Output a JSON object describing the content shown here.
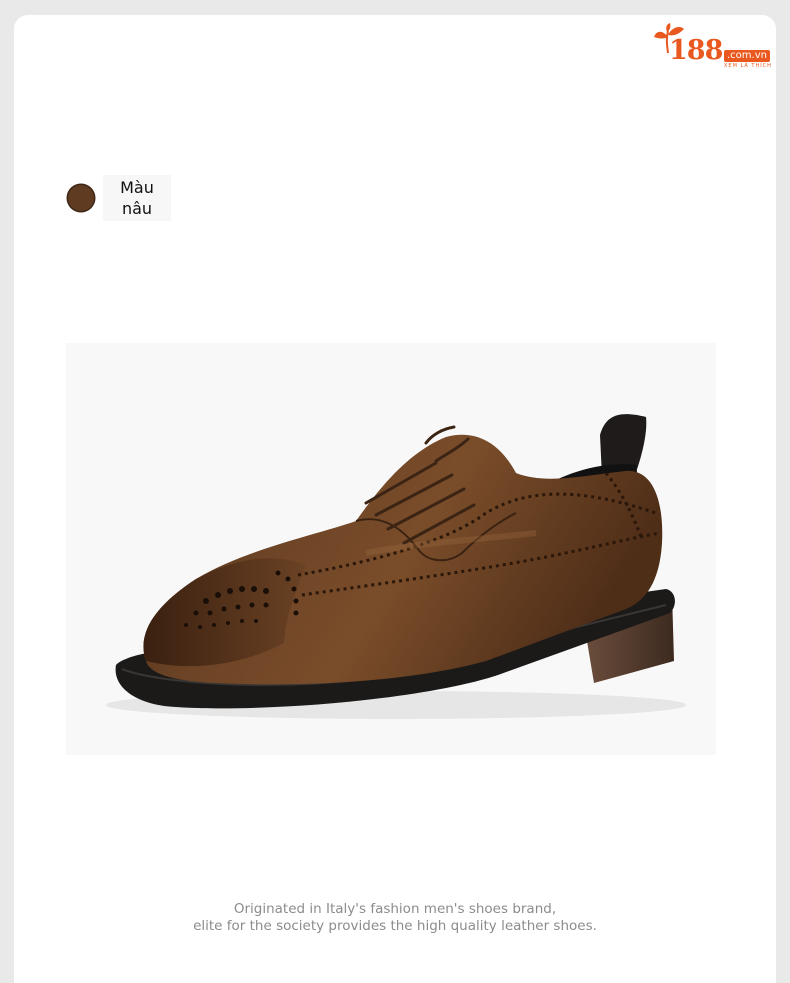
{
  "brand": {
    "number": "188",
    "domain": ".com.vn",
    "tagline": "XEM LÀ THÍCH",
    "color": "#e8581f"
  },
  "color_option": {
    "label_line1": "Màu",
    "label_line2": "nâu",
    "swatch_color": "#5e3b21"
  },
  "product": {
    "image": "brown-leather-brogue-derby-shoe"
  },
  "caption": {
    "line1": "Originated in Italy's fashion men's shoes brand,",
    "line2": "elite for the society provides the high quality leather shoes."
  }
}
